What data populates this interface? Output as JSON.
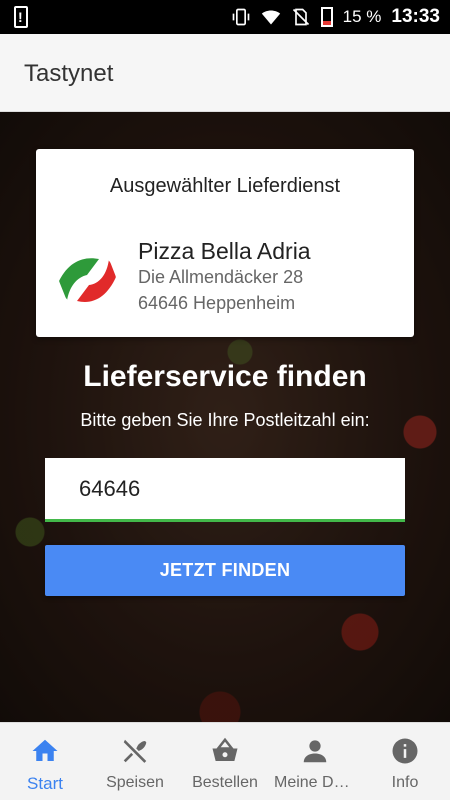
{
  "statusbar": {
    "battery_percent": "15 %",
    "time": "13:33"
  },
  "appbar": {
    "title": "Tastynet"
  },
  "card": {
    "heading": "Ausgewählter Lieferdienst",
    "restaurant_name": "Pizza Bella Adria",
    "address_line1": "Die Allmendäcker 28",
    "address_line2": "64646 Heppenheim"
  },
  "search": {
    "heading": "Lieferservice finden",
    "subtitle": "Bitte geben Sie Ihre Postleitzahl ein:",
    "postcode_value": "64646",
    "button_label": "JETZT FINDEN"
  },
  "bottom_nav": {
    "items": [
      {
        "label": "Start",
        "icon": "home-icon",
        "active": true
      },
      {
        "label": "Speisen",
        "icon": "cutlery-icon",
        "active": false
      },
      {
        "label": "Bestellen",
        "icon": "basket-icon",
        "active": false
      },
      {
        "label": "Meine Dat...",
        "icon": "person-icon",
        "active": false
      },
      {
        "label": "Info",
        "icon": "info-icon",
        "active": false
      }
    ]
  },
  "colors": {
    "accent": "#4a8af4",
    "nav_active": "#3b82f0",
    "input_underline": "#43b84a"
  }
}
